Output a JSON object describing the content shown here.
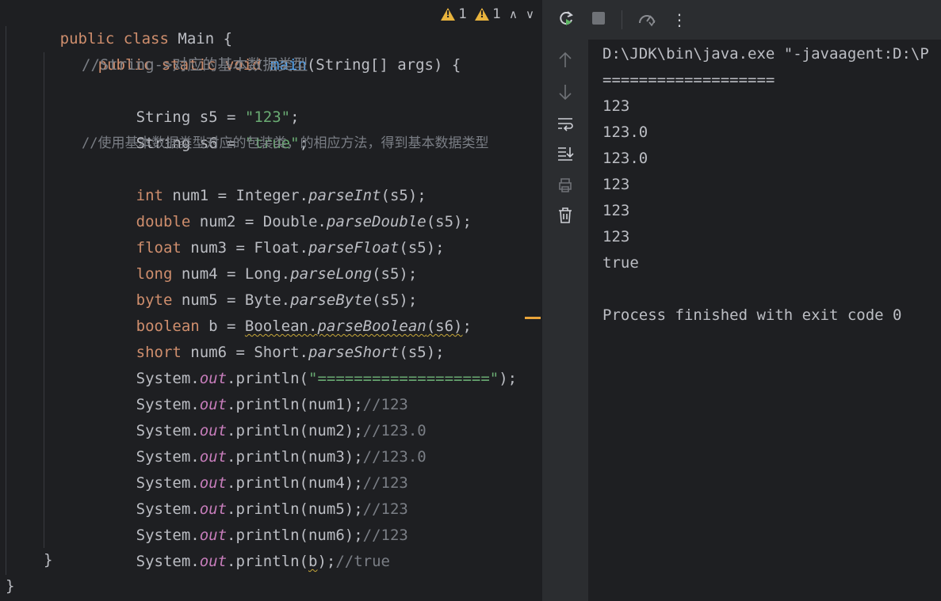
{
  "inspections": {
    "warnings_a": "1",
    "warnings_b": "1"
  },
  "code": {
    "l1": [
      "public",
      " ",
      "class",
      " Main {"
    ],
    "l2": [
      "public",
      " ",
      "static",
      " ",
      "void",
      " ",
      "main",
      "(String[] args) {"
    ],
    "l3": "//String->对应的基本数据类型",
    "l4": [
      "String s5 = ",
      "\"123\"",
      ";"
    ],
    "l5": [
      "String s6 = ",
      "\"true\"",
      ";"
    ],
    "l6": "//使用基本数据类型对应的包装类，的相应方法，得到基本数据类型",
    "l7": [
      "int",
      " num1 = Integer.",
      "parseInt",
      "(s5);"
    ],
    "l8": [
      "double",
      " num2 = Double.",
      "parseDouble",
      "(s5);"
    ],
    "l9": [
      "float",
      " num3 = Float.",
      "parseFloat",
      "(s5);"
    ],
    "l10": [
      "long",
      " num4 = Long.",
      "parseLong",
      "(s5);"
    ],
    "l11": [
      "byte",
      " num5 = Byte.",
      "parseByte",
      "(s5);"
    ],
    "l12": [
      "boolean",
      " b = ",
      "Boolean.",
      "parseBoolean",
      "(s6)",
      ";"
    ],
    "l13": [
      "short",
      " num6 = Short.",
      "parseShort",
      "(s5);"
    ],
    "l14": [
      "System.",
      "out",
      ".println(",
      "\"===================\"",
      ");"
    ],
    "l15": [
      "System.",
      "out",
      ".println(num1);",
      "//123"
    ],
    "l16": [
      "System.",
      "out",
      ".println(num2);",
      "//123.0"
    ],
    "l17": [
      "System.",
      "out",
      ".println(num3);",
      "//123.0"
    ],
    "l18": [
      "System.",
      "out",
      ".println(num4);",
      "//123"
    ],
    "l19": [
      "System.",
      "out",
      ".println(num5);",
      "//123"
    ],
    "l20": [
      "System.",
      "out",
      ".println(num6);",
      "//123"
    ],
    "l21": [
      "System.",
      "out",
      ".println(",
      "b",
      ");",
      "//true"
    ],
    "l22": "}",
    "l23": "}"
  },
  "toolbar": {
    "rerun_icon": "rerun-icon",
    "stop_icon": "stop-icon",
    "coverage_icon": "coverage-icon",
    "more_icon": "more-vertical-icon"
  },
  "console": {
    "lines": [
      "D:\\JDK\\bin\\java.exe \"-javaagent:D:\\P",
      "===================",
      "123",
      "123.0",
      "123.0",
      "123",
      "123",
      "123",
      "true",
      "",
      "Process finished with exit code 0"
    ]
  }
}
